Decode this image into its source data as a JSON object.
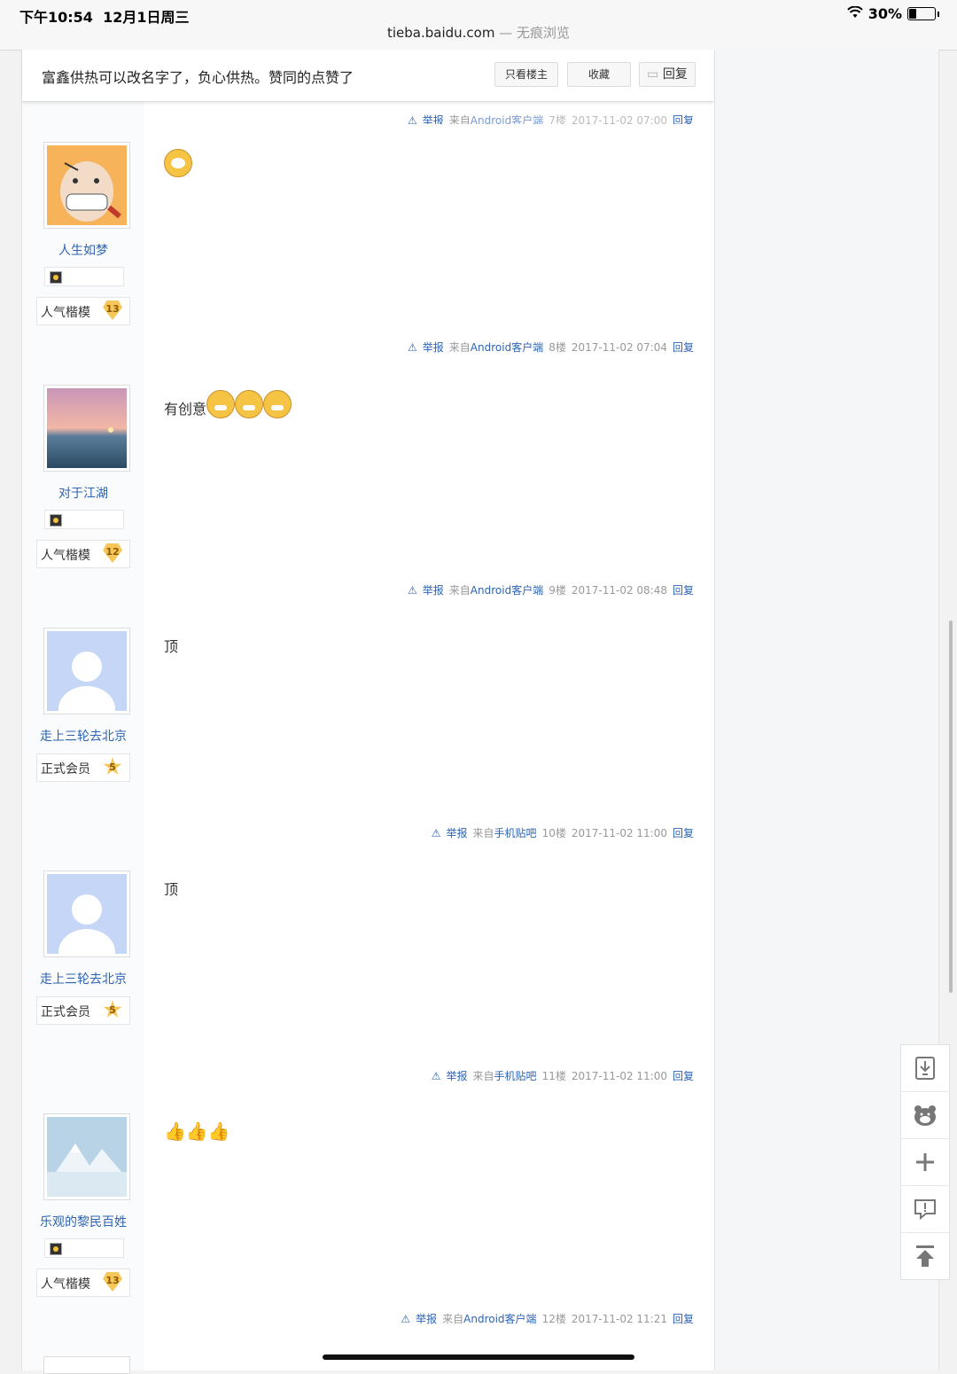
{
  "status": {
    "time": "下午10:54",
    "date": "12月1日周三",
    "battery": "30%",
    "url": "tieba.baidu.com",
    "private_mode": "— 无痕浏览"
  },
  "thread": {
    "title": "富鑫供热可以改名字了，负心供热。赞同的点赞了",
    "only_op": "只看楼主",
    "favorite": "收藏",
    "reply": "回复"
  },
  "prev_tail": {
    "report": "举报",
    "source": "来自",
    "client": "Android客户端",
    "floor": "7楼",
    "time": "2017-11-02 07:00",
    "reply": "回复"
  },
  "posts": [
    {
      "username": "人生如梦",
      "level_name": "人气楷模",
      "level": "13",
      "content": "",
      "report": "举报",
      "source": "来自",
      "client": "Android客户端",
      "floor": "8楼",
      "time": "2017-11-02 07:04",
      "reply": "回复"
    },
    {
      "username": "对于江湖",
      "level_name": "人气楷模",
      "level": "12",
      "content": "有创意",
      "report": "举报",
      "source": "来自",
      "client": "Android客户端",
      "floor": "9楼",
      "time": "2017-11-02 08:48",
      "reply": "回复"
    },
    {
      "username": "走上三轮去北京",
      "level_name": "正式会员",
      "level": "5",
      "content": "顶",
      "report": "举报",
      "source": "来自",
      "client": "手机贴吧",
      "floor": "10楼",
      "time": "2017-11-02 11:00",
      "reply": "回复"
    },
    {
      "username": "走上三轮去北京",
      "level_name": "正式会员",
      "level": "5",
      "content": "顶",
      "report": "举报",
      "source": "来自",
      "client": "手机贴吧",
      "floor": "11楼",
      "time": "2017-11-02 11:00",
      "reply": "回复"
    },
    {
      "username": "乐观的黎民百姓",
      "level_name": "人气楷模",
      "level": "13",
      "content": "",
      "report": "举报",
      "source": "来自",
      "client": "Android客户端",
      "floor": "12楼",
      "time": "2017-11-02 11:21",
      "reply": "回复"
    }
  ],
  "tools": [
    "download-icon",
    "bear-face-icon",
    "plus-icon",
    "feedback-icon",
    "back-to-top-icon"
  ],
  "colors": {
    "link": "#2d64b3",
    "meta": "#999999",
    "level_badge": "#f6c659"
  }
}
